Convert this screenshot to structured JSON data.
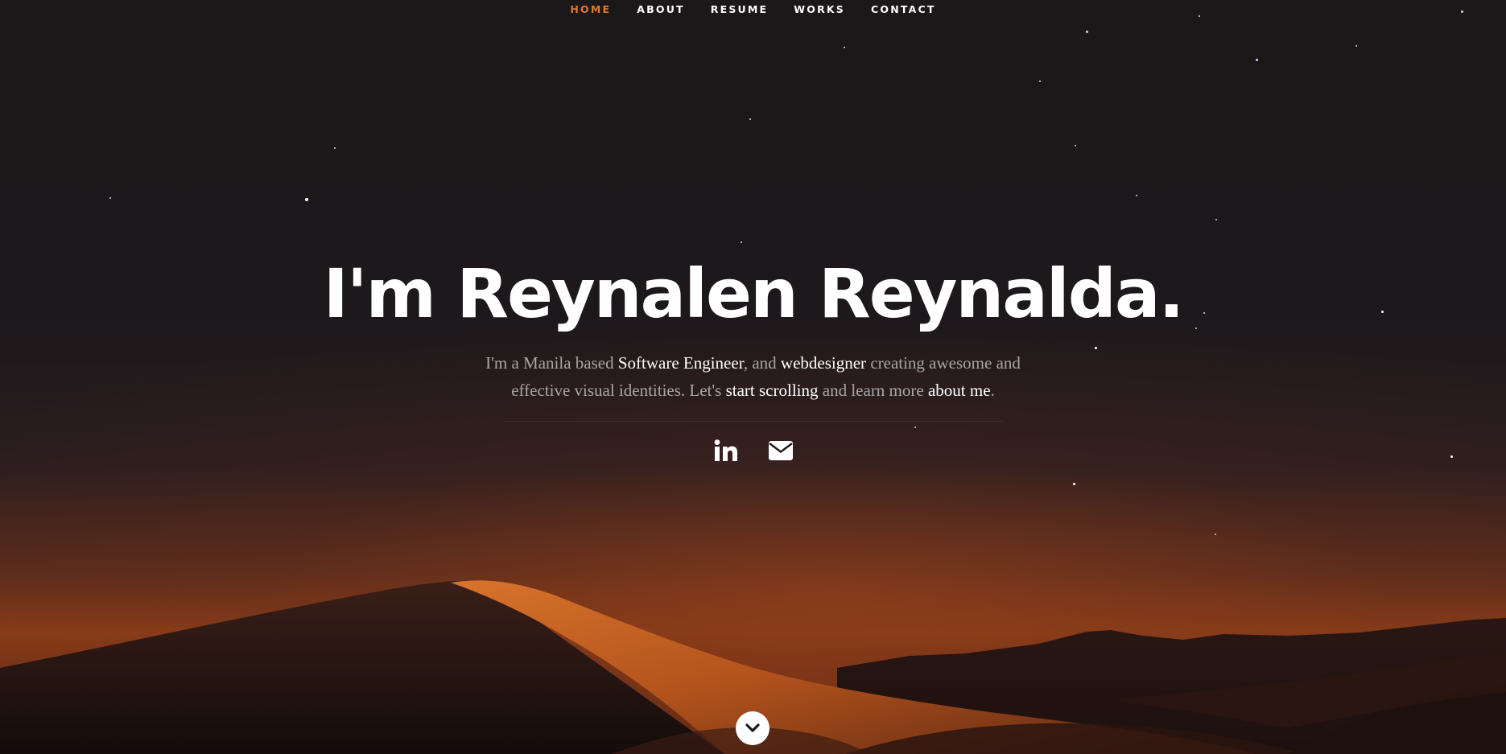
{
  "nav": {
    "items": [
      {
        "label": "HOME",
        "active": true
      },
      {
        "label": "ABOUT",
        "active": false
      },
      {
        "label": "RESUME",
        "active": false
      },
      {
        "label": "WORKS",
        "active": false
      },
      {
        "label": "CONTACT",
        "active": false
      }
    ]
  },
  "hero": {
    "title": "I'm Reynalen Reynalda.",
    "intro": {
      "p1": "I'm a Manila based ",
      "h1": "Software Engineer",
      "p2": ", and ",
      "h2": "webdesigner",
      "p3": " creating awesome and effective visual identities. Let's ",
      "h3": "start scrolling",
      "p4": " and learn more ",
      "h4": "about me",
      "p5": "."
    }
  },
  "social": {
    "icons": [
      "linkedin-icon",
      "envelope-icon"
    ]
  },
  "scroll_down": {
    "icon": "chevron-down-icon"
  },
  "colors": {
    "accent": "#e5772a",
    "background": "#1b181a",
    "text_primary": "#ffffff",
    "text_muted": "#a9a5a6"
  }
}
